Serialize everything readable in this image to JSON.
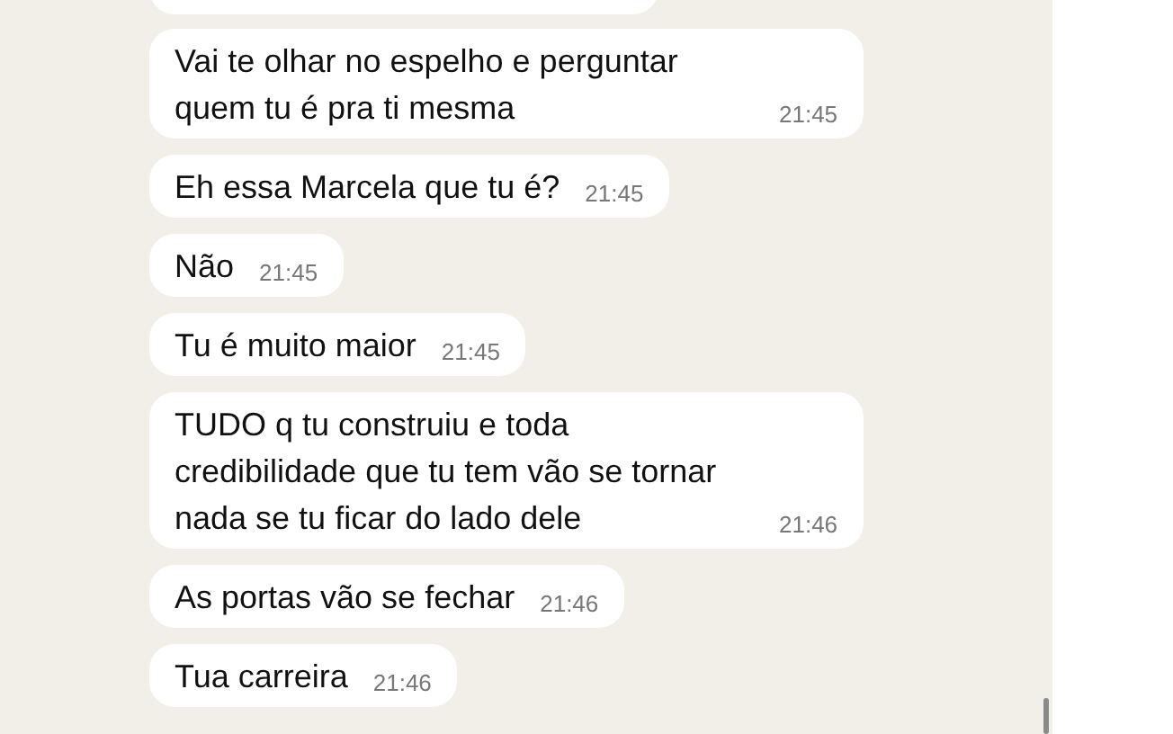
{
  "messages": [
    {
      "text": "Vai te olhar no espelho e perguntar quem tu é pra ti mesma",
      "time": "21:45"
    },
    {
      "text": "Eh essa Marcela que tu é?",
      "time": "21:45"
    },
    {
      "text": "Não",
      "time": "21:45"
    },
    {
      "text": "Tu é muito maior",
      "time": "21:45"
    },
    {
      "text": "TUDO q tu construiu e toda credibilidade que tu tem vão se tornar nada se tu ficar do lado dele",
      "time": "21:46"
    },
    {
      "text": "As portas vão se fechar",
      "time": "21:46"
    },
    {
      "text": "Tua carreira",
      "time": "21:46"
    }
  ]
}
